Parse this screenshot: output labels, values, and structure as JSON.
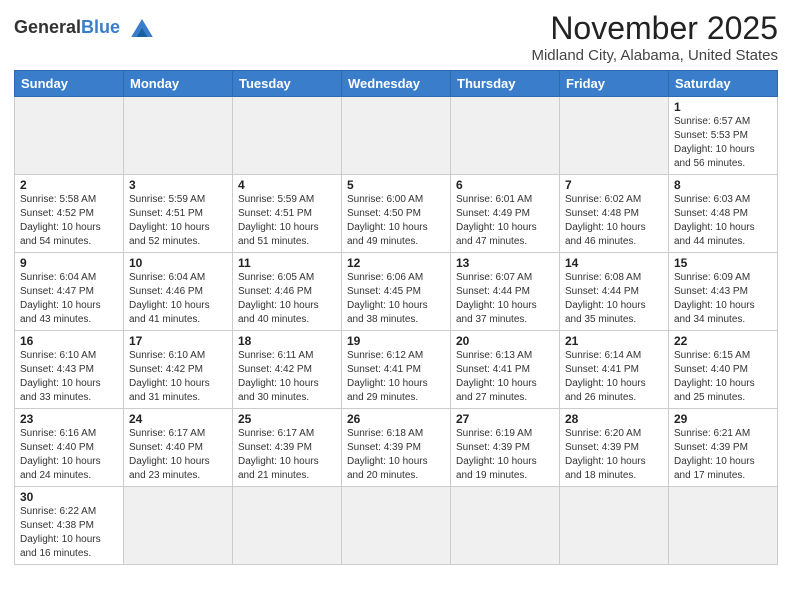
{
  "header": {
    "logo_general": "General",
    "logo_blue": "Blue",
    "title": "November 2025",
    "subtitle": "Midland City, Alabama, United States"
  },
  "weekdays": [
    "Sunday",
    "Monday",
    "Tuesday",
    "Wednesday",
    "Thursday",
    "Friday",
    "Saturday"
  ],
  "weeks": [
    [
      {
        "day": null,
        "empty": true
      },
      {
        "day": null,
        "empty": true
      },
      {
        "day": null,
        "empty": true
      },
      {
        "day": null,
        "empty": true
      },
      {
        "day": null,
        "empty": true
      },
      {
        "day": null,
        "empty": true
      },
      {
        "day": 1,
        "sunrise": "6:57 AM",
        "sunset": "5:53 PM",
        "daylight": "10 hours and 56 minutes."
      }
    ],
    [
      {
        "day": 2,
        "sunrise": "5:58 AM",
        "sunset": "4:52 PM",
        "daylight": "10 hours and 54 minutes."
      },
      {
        "day": 3,
        "sunrise": "5:59 AM",
        "sunset": "4:51 PM",
        "daylight": "10 hours and 52 minutes."
      },
      {
        "day": 4,
        "sunrise": "5:59 AM",
        "sunset": "4:51 PM",
        "daylight": "10 hours and 51 minutes."
      },
      {
        "day": 5,
        "sunrise": "6:00 AM",
        "sunset": "4:50 PM",
        "daylight": "10 hours and 49 minutes."
      },
      {
        "day": 6,
        "sunrise": "6:01 AM",
        "sunset": "4:49 PM",
        "daylight": "10 hours and 47 minutes."
      },
      {
        "day": 7,
        "sunrise": "6:02 AM",
        "sunset": "4:48 PM",
        "daylight": "10 hours and 46 minutes."
      },
      {
        "day": 8,
        "sunrise": "6:03 AM",
        "sunset": "4:48 PM",
        "daylight": "10 hours and 44 minutes."
      }
    ],
    [
      {
        "day": 9,
        "sunrise": "6:04 AM",
        "sunset": "4:47 PM",
        "daylight": "10 hours and 43 minutes."
      },
      {
        "day": 10,
        "sunrise": "6:04 AM",
        "sunset": "4:46 PM",
        "daylight": "10 hours and 41 minutes."
      },
      {
        "day": 11,
        "sunrise": "6:05 AM",
        "sunset": "4:46 PM",
        "daylight": "10 hours and 40 minutes."
      },
      {
        "day": 12,
        "sunrise": "6:06 AM",
        "sunset": "4:45 PM",
        "daylight": "10 hours and 38 minutes."
      },
      {
        "day": 13,
        "sunrise": "6:07 AM",
        "sunset": "4:44 PM",
        "daylight": "10 hours and 37 minutes."
      },
      {
        "day": 14,
        "sunrise": "6:08 AM",
        "sunset": "4:44 PM",
        "daylight": "10 hours and 35 minutes."
      },
      {
        "day": 15,
        "sunrise": "6:09 AM",
        "sunset": "4:43 PM",
        "daylight": "10 hours and 34 minutes."
      }
    ],
    [
      {
        "day": 16,
        "sunrise": "6:10 AM",
        "sunset": "4:43 PM",
        "daylight": "10 hours and 33 minutes."
      },
      {
        "day": 17,
        "sunrise": "6:10 AM",
        "sunset": "4:42 PM",
        "daylight": "10 hours and 31 minutes."
      },
      {
        "day": 18,
        "sunrise": "6:11 AM",
        "sunset": "4:42 PM",
        "daylight": "10 hours and 30 minutes."
      },
      {
        "day": 19,
        "sunrise": "6:12 AM",
        "sunset": "4:41 PM",
        "daylight": "10 hours and 29 minutes."
      },
      {
        "day": 20,
        "sunrise": "6:13 AM",
        "sunset": "4:41 PM",
        "daylight": "10 hours and 27 minutes."
      },
      {
        "day": 21,
        "sunrise": "6:14 AM",
        "sunset": "4:41 PM",
        "daylight": "10 hours and 26 minutes."
      },
      {
        "day": 22,
        "sunrise": "6:15 AM",
        "sunset": "4:40 PM",
        "daylight": "10 hours and 25 minutes."
      }
    ],
    [
      {
        "day": 23,
        "sunrise": "6:16 AM",
        "sunset": "4:40 PM",
        "daylight": "10 hours and 24 minutes."
      },
      {
        "day": 24,
        "sunrise": "6:17 AM",
        "sunset": "4:40 PM",
        "daylight": "10 hours and 23 minutes."
      },
      {
        "day": 25,
        "sunrise": "6:17 AM",
        "sunset": "4:39 PM",
        "daylight": "10 hours and 21 minutes."
      },
      {
        "day": 26,
        "sunrise": "6:18 AM",
        "sunset": "4:39 PM",
        "daylight": "10 hours and 20 minutes."
      },
      {
        "day": 27,
        "sunrise": "6:19 AM",
        "sunset": "4:39 PM",
        "daylight": "10 hours and 19 minutes."
      },
      {
        "day": 28,
        "sunrise": "6:20 AM",
        "sunset": "4:39 PM",
        "daylight": "10 hours and 18 minutes."
      },
      {
        "day": 29,
        "sunrise": "6:21 AM",
        "sunset": "4:39 PM",
        "daylight": "10 hours and 17 minutes."
      }
    ],
    [
      {
        "day": 30,
        "sunrise": "6:22 AM",
        "sunset": "4:38 PM",
        "daylight": "10 hours and 16 minutes."
      },
      {
        "day": null,
        "empty": true
      },
      {
        "day": null,
        "empty": true
      },
      {
        "day": null,
        "empty": true
      },
      {
        "day": null,
        "empty": true
      },
      {
        "day": null,
        "empty": true
      },
      {
        "day": null,
        "empty": true
      }
    ]
  ]
}
